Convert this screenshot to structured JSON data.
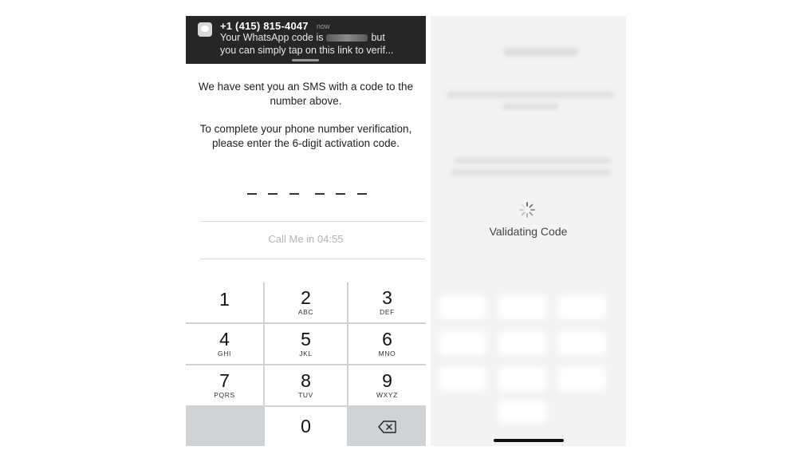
{
  "notification": {
    "sender": "+1 (415) 815-4047",
    "time": "now",
    "line1_prefix": "Your WhatsApp code is",
    "line1_suffix": "but",
    "line2": "you can simply tap on this link to verif..."
  },
  "verification": {
    "sms_message": "We have sent you an SMS with a code to the number above.",
    "instruction": "To complete your phone number verification, please enter the 6-digit activation code.",
    "call_me_label": "Call Me in 04:55"
  },
  "keypad": {
    "keys": [
      {
        "num": "1",
        "letters": ""
      },
      {
        "num": "2",
        "letters": "ABC"
      },
      {
        "num": "3",
        "letters": "DEF"
      },
      {
        "num": "4",
        "letters": "GHI"
      },
      {
        "num": "5",
        "letters": "JKL"
      },
      {
        "num": "6",
        "letters": "MNO"
      },
      {
        "num": "7",
        "letters": "PQRS"
      },
      {
        "num": "8",
        "letters": "TUV"
      },
      {
        "num": "9",
        "letters": "WXYZ"
      },
      {
        "num": "0",
        "letters": ""
      }
    ],
    "delete_icon": "backspace-icon"
  },
  "validating": {
    "label": "Validating Code",
    "icon": "spinner-icon"
  }
}
